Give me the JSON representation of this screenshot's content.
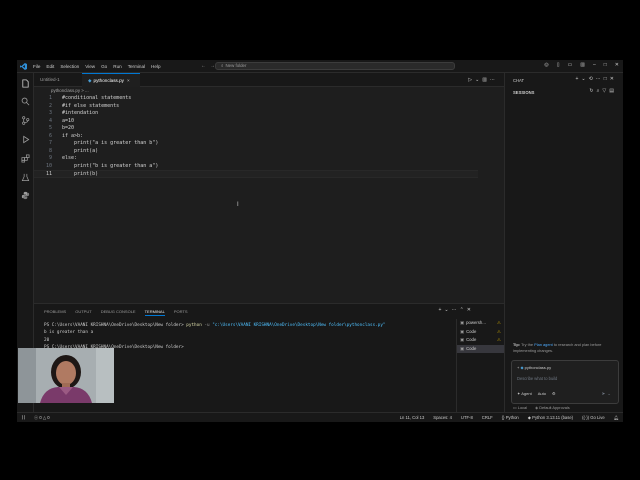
{
  "menu": [
    "File",
    "Edit",
    "Selection",
    "View",
    "Go",
    "Run",
    "Terminal",
    "Help"
  ],
  "search": {
    "placeholder": "New folder"
  },
  "tabs": [
    {
      "label": "Untitled-1",
      "active": false
    },
    {
      "label": "pythonclass.py",
      "active": true,
      "close": "×"
    }
  ],
  "breadcrumb": "pythonclass.py > ...",
  "editor": {
    "lines": [
      {
        "n": "1",
        "text": "#conditional statements"
      },
      {
        "n": "2",
        "text": "#if else statements"
      },
      {
        "n": "3",
        "text": "#intendation"
      },
      {
        "n": "4",
        "text": "a=10"
      },
      {
        "n": "5",
        "text": "b=20"
      },
      {
        "n": "6",
        "text": "if a>b:"
      },
      {
        "n": "7",
        "text": "    print(\"a is greater than b\")"
      },
      {
        "n": "8",
        "text": "    print(a)"
      },
      {
        "n": "9",
        "text": "else:"
      },
      {
        "n": "10",
        "text": "    print(\"b is greater than a\")"
      },
      {
        "n": "11",
        "text": "    print(b)"
      }
    ]
  },
  "panel": {
    "tabs": [
      "PROBLEMS",
      "OUTPUT",
      "DEBUG CONSOLE",
      "TERMINAL",
      "PORTS"
    ],
    "active_tab": "TERMINAL",
    "terminal": {
      "prompt1": "PS C:\\Users\\VAANI KRISHNA\\OneDrive\\Desktop\\New folder> ",
      "cmd": "python",
      "flag": " -u ",
      "path": "\"c:\\Users\\VAANI KRISHNA\\OneDrive\\Desktop\\New folder\\pythonclass.py\"",
      "out1": "b is greater than a",
      "out2": "20",
      "prompt2": "PS C:\\Users\\VAANI KRISHNA\\OneDrive\\Desktop\\New folder>"
    },
    "terminals": [
      {
        "label": "powersh...",
        "warn": true
      },
      {
        "label": "Code",
        "warn": true
      },
      {
        "label": "Code",
        "warn": true
      },
      {
        "label": "Code",
        "warn": false,
        "selected": true
      }
    ]
  },
  "chat": {
    "title": "CHAT",
    "sessions": "SESSIONS",
    "tip": {
      "label": "Tip:",
      "pre": " Try the ",
      "link": "Plan agent",
      "post": " to research and plan before implementing changes."
    },
    "context_file": "pythonclass.py",
    "placeholder": "Describe what to build",
    "mode": "Agent",
    "model": "Auto",
    "footer_local": "Local",
    "footer_approvals": "Default Approvals"
  },
  "status": {
    "errors": "0",
    "warnings": "0",
    "position": "Ln 11, Col 13",
    "spaces": "Spaces: 4",
    "encoding": "UTF-8",
    "eol": "CRLF",
    "language": "Python",
    "interpreter": "Python 3.13.11 (base)",
    "golive": "Go Live"
  },
  "colors": {
    "accent": "#0078d4",
    "editor_bg": "#1e1e1e",
    "sidebar_bg": "#181818",
    "warning": "#cca700"
  }
}
